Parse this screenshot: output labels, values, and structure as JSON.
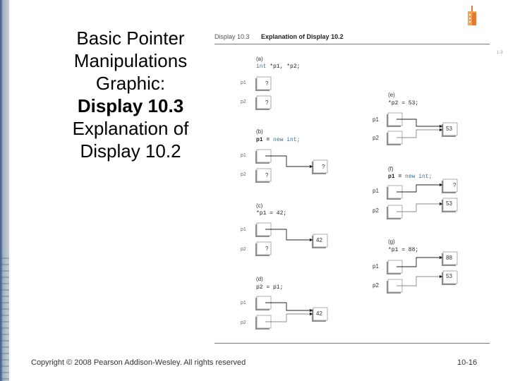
{
  "slide": {
    "title_lines": [
      "Basic Pointer",
      "Manipulations",
      "Graphic:"
    ],
    "title_bold": "Display 10.3",
    "title_tail_lines": [
      "Explanation of",
      "Display 10.2"
    ],
    "footer_copyright": "Copyright © 2008 Pearson Addison-Wesley. All rights reserved",
    "page_number": "10-16",
    "side_mark": "1-3"
  },
  "figure": {
    "display_number": "Display 10.3",
    "caption": "Explanation of Display 10.2",
    "steps": [
      {
        "label": "(a)",
        "code_kw": "int",
        "code_rest": " *p1, *p2;",
        "p1": "p1",
        "p2": "p2",
        "p1_value": "?",
        "p2_value": "?"
      },
      {
        "label": "(b)",
        "code_prefix": "p1 = ",
        "code_kw": "new int;",
        "p1": "p1",
        "p2": "p2",
        "p2_value": "?",
        "heap": [
          "?"
        ]
      },
      {
        "label": "(c)",
        "code": "*p1 = 42;",
        "p1": "p1",
        "p2": "p2",
        "p2_value": "?",
        "heap": [
          "42"
        ]
      },
      {
        "label": "(d)",
        "code": "p2 = p1;",
        "p1": "p1",
        "p2": "p2",
        "heap": [
          "42"
        ]
      },
      {
        "label": "(e)",
        "code": "*p2 = 53;",
        "p1": "p1",
        "p2": "p2",
        "heap": [
          "53"
        ]
      },
      {
        "label": "(f)",
        "code_prefix": "p1 = ",
        "code_kw": "new int;",
        "p1": "p1",
        "p2": "p2",
        "heap": [
          "?",
          "53"
        ]
      },
      {
        "label": "(g)",
        "code": "*p1 = 88;",
        "p1": "p1",
        "p2": "p2",
        "heap": [
          "88",
          "53"
        ]
      }
    ]
  },
  "colors": {
    "keyword": "#3a6fa6",
    "logo": "#e8782a"
  }
}
